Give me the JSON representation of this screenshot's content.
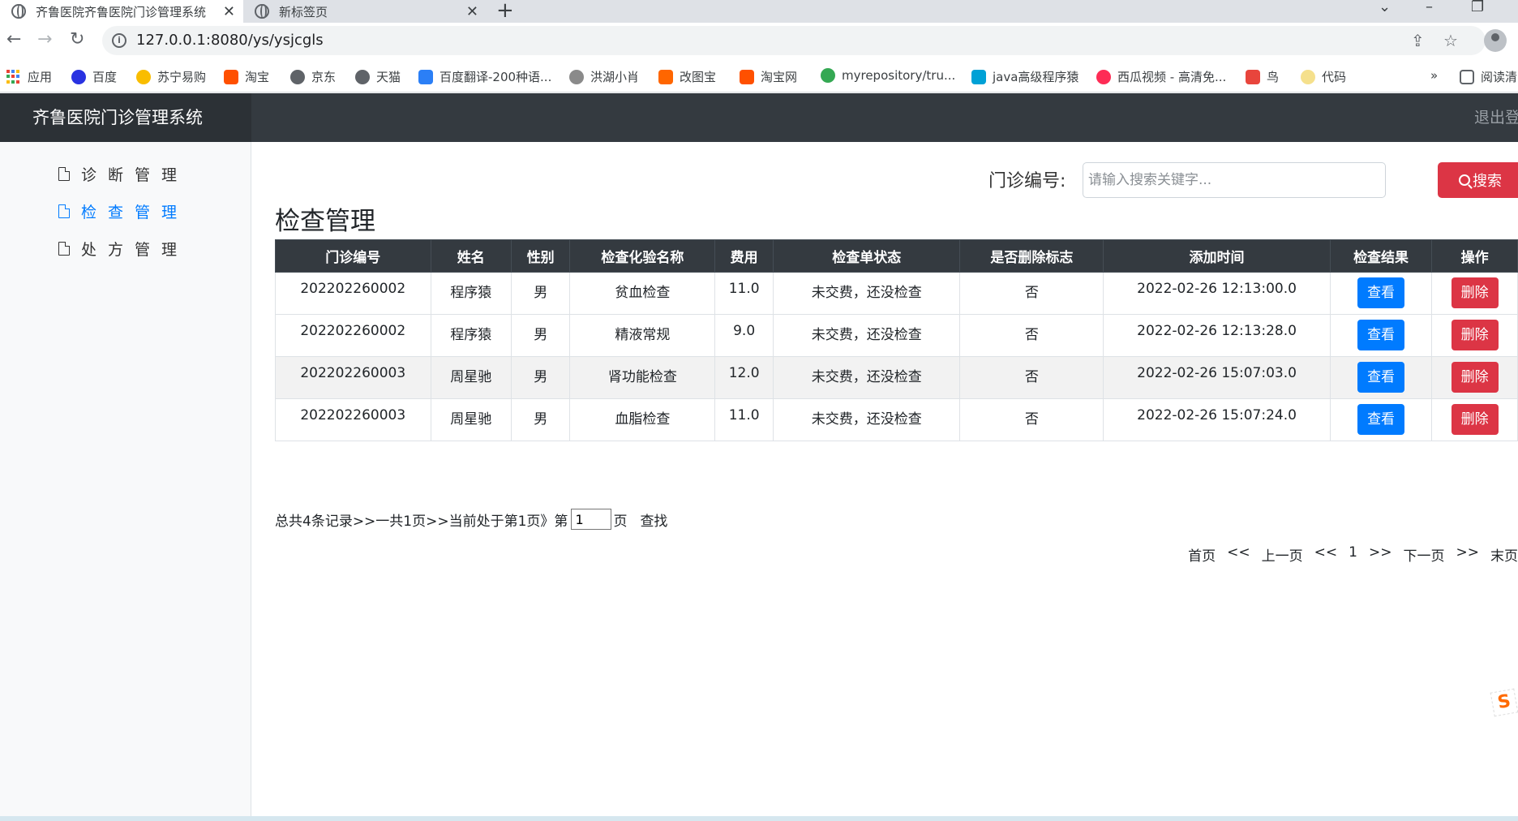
{
  "browser": {
    "tabs": [
      {
        "title": "齐鲁医院齐鲁医院门诊管理系统",
        "active": true
      },
      {
        "title": "新标签页",
        "active": false
      }
    ],
    "new_tab_glyph": "+",
    "url": "127.0.0.1:8080/ys/ysjcgls",
    "bookmarks": [
      {
        "label": "应用",
        "icon": "apps-grid-icon",
        "color": "#4285f4"
      },
      {
        "label": "百度",
        "icon": "baidu-icon",
        "color": "#2932e1"
      },
      {
        "label": "苏宁易购",
        "icon": "suning-icon",
        "color": "#f9bd00"
      },
      {
        "label": "淘宝",
        "icon": "taobao-icon",
        "color": "#ff5000"
      },
      {
        "label": "京东",
        "icon": "globe-icon",
        "color": "#5f6368"
      },
      {
        "label": "天猫",
        "icon": "globe-icon",
        "color": "#5f6368"
      },
      {
        "label": "百度翻译-200种语...",
        "icon": "translate-icon",
        "color": "#2b7ff6"
      },
      {
        "label": "洪湖小肖",
        "icon": "bird-icon",
        "color": "#8a8a8a"
      },
      {
        "label": "改图宝",
        "icon": "gaitubao-icon",
        "color": "#ff6600"
      },
      {
        "label": "淘宝网",
        "icon": "taobao-icon",
        "color": "#ff5000"
      },
      {
        "label": "myrepository/tru...",
        "icon": "chrome-icon",
        "color": "#34a853"
      },
      {
        "label": "java高级程序猿",
        "icon": "bilibili-icon",
        "color": "#00a1d6"
      },
      {
        "label": "西瓜视频 - 高清免...",
        "icon": "xigua-icon",
        "color": "#fe2c55"
      },
      {
        "label": "鸟",
        "icon": "bird-icon",
        "color": "#e8453c"
      },
      {
        "label": "代码",
        "icon": "code-icon",
        "color": "#f5e08c"
      }
    ],
    "bookmarks_overflow": "»",
    "reading_list": "阅读清"
  },
  "app": {
    "brand": "齐鲁医院门诊管理系统",
    "logout": "退出登",
    "sidebar": [
      {
        "label": "诊断管理",
        "active": false
      },
      {
        "label": "检查管理",
        "active": true
      },
      {
        "label": "处方管理",
        "active": false
      }
    ],
    "search": {
      "label": "门诊编号:",
      "placeholder": "请输入搜索关键字...",
      "value": "",
      "button": "搜索"
    },
    "page_title": "检查管理",
    "table": {
      "headers": [
        "门诊编号",
        "姓名",
        "性别",
        "检查化验名称",
        "费用",
        "检查单状态",
        "是否删除标志",
        "添加时间",
        "检查结果",
        "操作"
      ],
      "rows": [
        {
          "id": "202202260002",
          "name": "程序猿",
          "gender": "男",
          "item": "贫血检查",
          "fee": "11.0",
          "status": "未交费，还没检查",
          "deleted": "否",
          "time": "2022-02-26 12:13:00.0",
          "view": "查看",
          "del": "删除"
        },
        {
          "id": "202202260002",
          "name": "程序猿",
          "gender": "男",
          "item": "精液常规",
          "fee": "9.0",
          "status": "未交费，还没检查",
          "deleted": "否",
          "time": "2022-02-26 12:13:28.0",
          "view": "查看",
          "del": "删除"
        },
        {
          "id": "202202260003",
          "name": "周星驰",
          "gender": "男",
          "item": "肾功能检查",
          "fee": "12.0",
          "status": "未交费，还没检查",
          "deleted": "否",
          "time": "2022-02-26 15:07:03.0",
          "view": "查看",
          "del": "删除"
        },
        {
          "id": "202202260003",
          "name": "周星驰",
          "gender": "男",
          "item": "血脂检查",
          "fee": "11.0",
          "status": "未交费，还没检查",
          "deleted": "否",
          "time": "2022-02-26 15:07:24.0",
          "view": "查看",
          "del": "删除"
        }
      ]
    },
    "summary": {
      "text": "总共4条记录>>一共1页>>当前处于第1页》第",
      "page_value": "1",
      "page_suffix": "页",
      "find": "查找"
    },
    "pager": {
      "first": "首页",
      "prev_arrow": "<<",
      "prev": "上一页",
      "prev_arrow2": "<<",
      "current": "1",
      "next_arrow": ">>",
      "next": "下一页",
      "next_arrow2": ">>",
      "last": "末页"
    },
    "colors": {
      "topbar": "#343a40",
      "primary": "#007bff",
      "danger": "#dc3545"
    }
  }
}
